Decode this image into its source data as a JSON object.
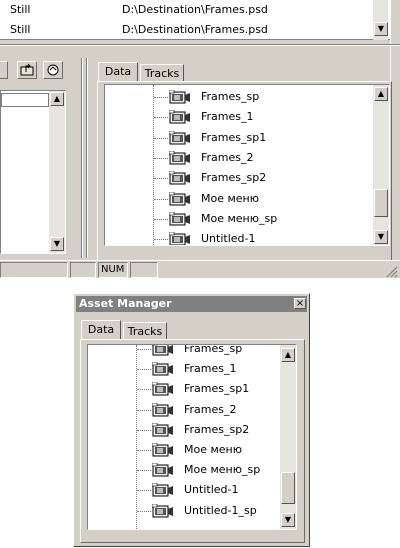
{
  "top_list": {
    "rows": [
      {
        "type": "Still",
        "path": "D:\\Destination\\Frames.psd"
      },
      {
        "type": "Still",
        "path": "D:\\Destination\\Frames.psd"
      }
    ]
  },
  "panel_top": {
    "tabs": [
      {
        "label": "Data"
      },
      {
        "label": "Tracks"
      }
    ],
    "tree_items": [
      {
        "label": "Frames_sp"
      },
      {
        "label": "Frames_1"
      },
      {
        "label": "Frames_sp1"
      },
      {
        "label": "Frames_2"
      },
      {
        "label": "Frames_sp2"
      },
      {
        "label": "Мое меню"
      },
      {
        "label": "Мое меню_sp"
      },
      {
        "label": "Untitled-1"
      }
    ]
  },
  "statusbar": {
    "num": "NUM"
  },
  "asset_manager": {
    "title": "Asset Manager",
    "close": "×",
    "tabs": [
      {
        "label": "Data"
      },
      {
        "label": "Tracks"
      }
    ],
    "tree_items": [
      {
        "label": "Frames_sp"
      },
      {
        "label": "Frames_1"
      },
      {
        "label": "Frames_sp1"
      },
      {
        "label": "Frames_2"
      },
      {
        "label": "Frames_sp2"
      },
      {
        "label": "Мое меню"
      },
      {
        "label": "Мое меню_sp"
      },
      {
        "label": "Untitled-1"
      },
      {
        "label": "Untitled-1_sp"
      }
    ]
  }
}
